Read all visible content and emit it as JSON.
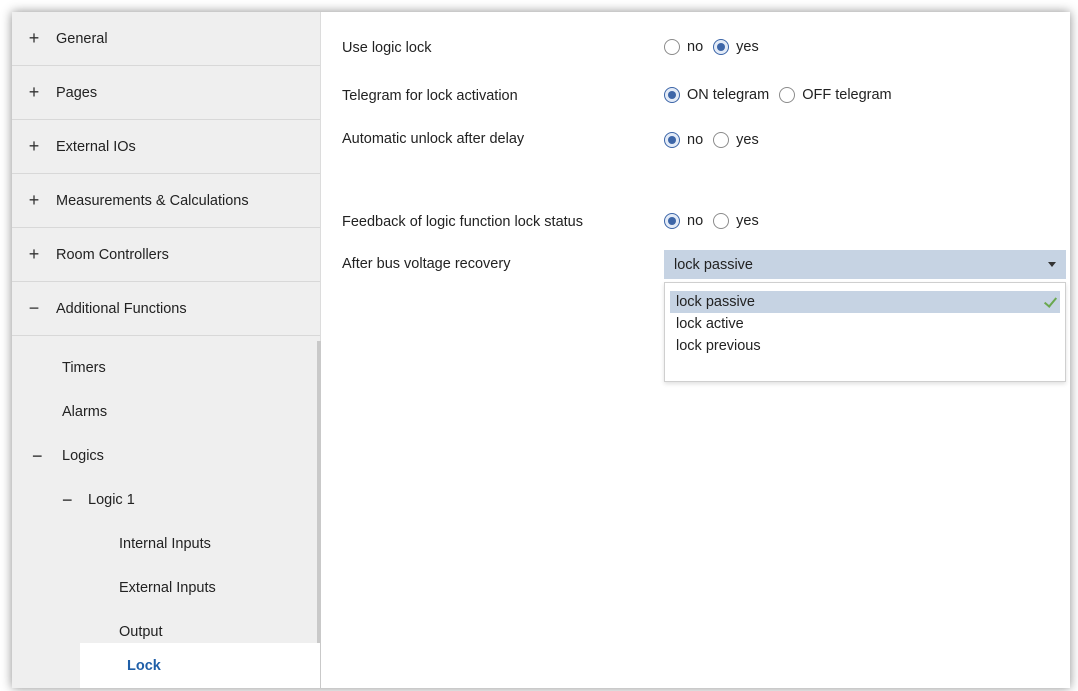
{
  "sidebar": {
    "top_items": [
      {
        "sign": "+",
        "label": "General"
      },
      {
        "sign": "+",
        "label": "Pages"
      },
      {
        "sign": "+",
        "label": "External IOs"
      },
      {
        "sign": "+",
        "label": "Measurements & Calculations"
      },
      {
        "sign": "+",
        "label": "Room Controllers"
      },
      {
        "sign": "−",
        "label": "Additional Functions"
      }
    ],
    "sub_items": {
      "timers": "Timers",
      "alarms": "Alarms",
      "logics_sign": "−",
      "logics": "Logics",
      "logic1_sign": "−",
      "logic1": "Logic 1",
      "internal_inputs": "Internal Inputs",
      "external_inputs": "External Inputs",
      "output": "Output",
      "lock": "Lock"
    }
  },
  "settings": {
    "use_logic_lock": {
      "label": "Use logic lock",
      "opt_no": "no",
      "opt_yes": "yes",
      "selected": "yes"
    },
    "telegram_lock": {
      "label": "Telegram for lock activation",
      "opt_on": "ON telegram",
      "opt_off": "OFF telegram",
      "selected": "ON telegram"
    },
    "auto_unlock": {
      "label": "Automatic unlock after delay",
      "opt_no": "no",
      "opt_yes": "yes",
      "selected": "no"
    },
    "feedback": {
      "label": "Feedback of logic function lock status",
      "opt_no": "no",
      "opt_yes": "yes",
      "selected": "no"
    },
    "bus_recovery": {
      "label": "After bus voltage recovery",
      "value": "lock passive",
      "options": [
        "lock passive",
        "lock active",
        "lock previous"
      ]
    }
  },
  "colors": {
    "accent": "#1f5fa8",
    "selection": "#c6d3e3",
    "check": "#6aa84f"
  }
}
